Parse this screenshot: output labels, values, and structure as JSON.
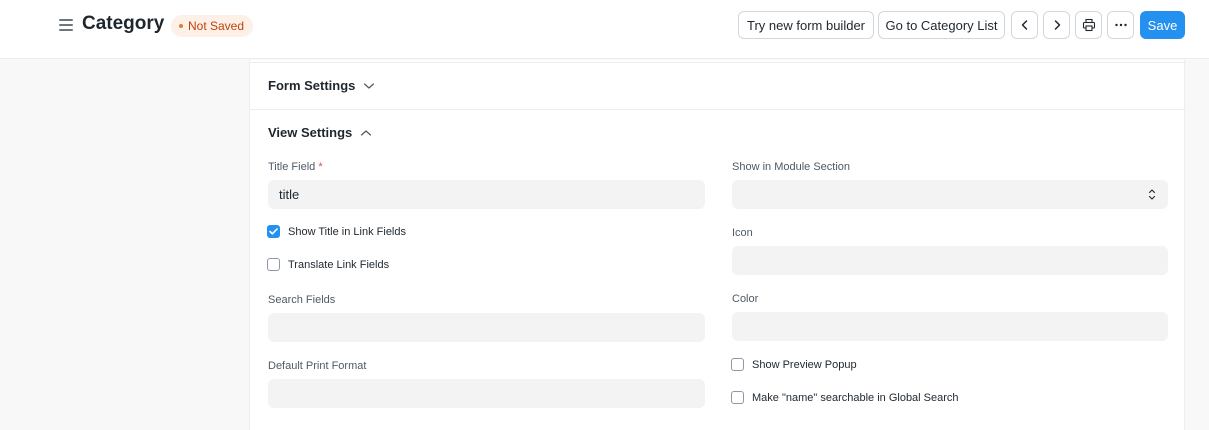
{
  "header": {
    "title": "Category",
    "status": "Not Saved",
    "buttons": {
      "new_form_builder": "Try new form builder",
      "go_to_list": "Go to Category List",
      "save": "Save"
    }
  },
  "sections": {
    "form_settings": {
      "title": "Form Settings"
    },
    "view_settings": {
      "title": "View Settings",
      "title_field": {
        "label": "Title Field",
        "required_mark": "*",
        "value": "title"
      },
      "show_title_in_link_fields": {
        "label": "Show Title in Link Fields",
        "checked": true
      },
      "translate_link_fields": {
        "label": "Translate Link Fields",
        "checked": false
      },
      "search_fields": {
        "label": "Search Fields",
        "value": ""
      },
      "default_print_format": {
        "label": "Default Print Format",
        "value": ""
      },
      "show_in_module_section": {
        "label": "Show in Module Section",
        "value": ""
      },
      "icon": {
        "label": "Icon",
        "value": ""
      },
      "color": {
        "label": "Color",
        "value": ""
      },
      "show_preview_popup": {
        "label": "Show Preview Popup",
        "checked": false
      },
      "make_name_searchable": {
        "label": "Make \"name\" searchable in Global Search",
        "checked": false
      }
    }
  },
  "colors": {
    "primary": "#2490ef",
    "badge_bg": "#fdf0e7",
    "badge_text": "#c2410c",
    "input_bg": "#f3f3f3"
  }
}
